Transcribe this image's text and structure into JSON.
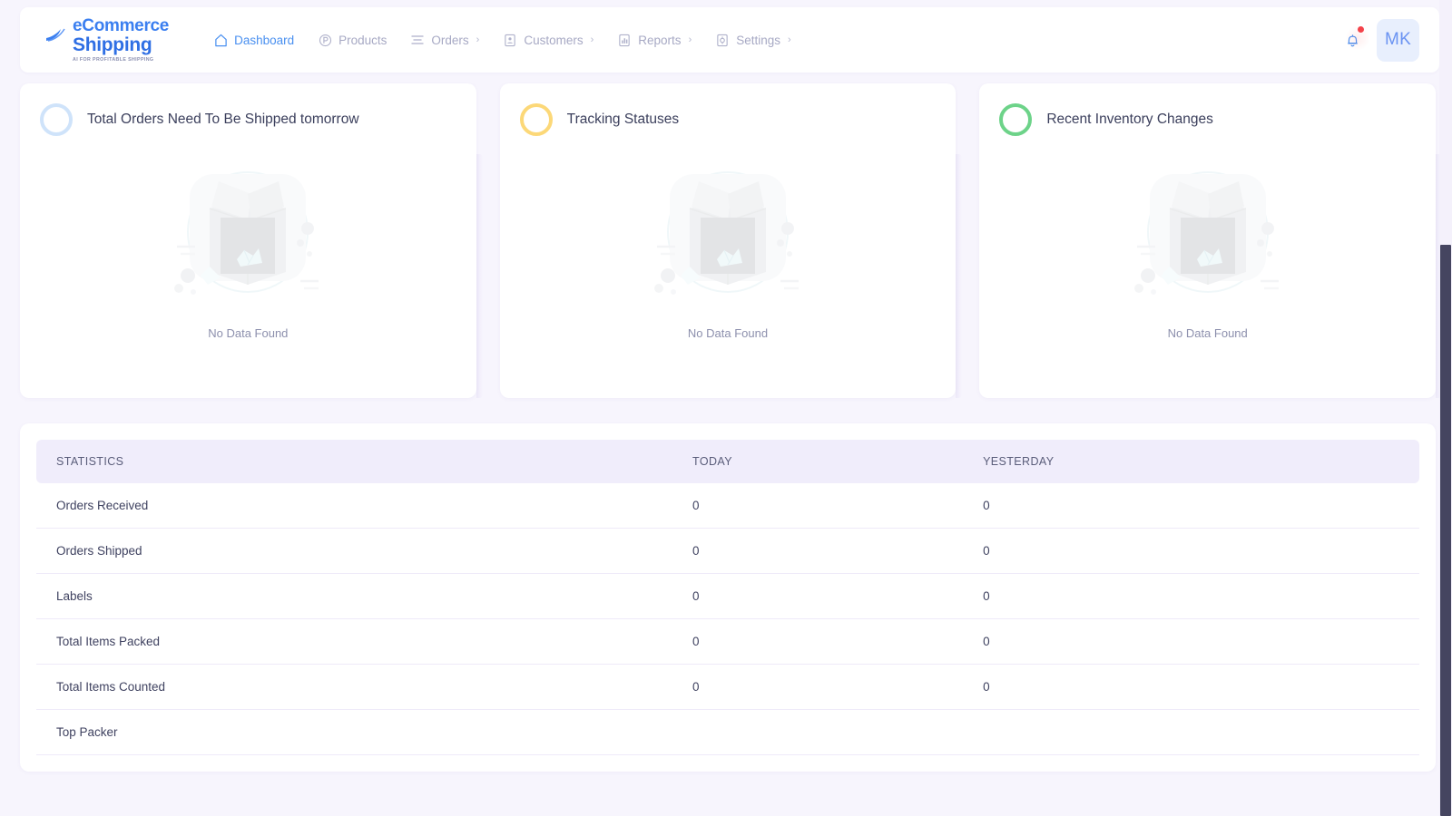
{
  "brand": {
    "name_line1": "eCommerce",
    "name_line2": "Shipping",
    "tagline": "AI FOR PROFITABLE SHIPPING",
    "logo_icon": "feather-wing-icon",
    "accent_color": "#3b7ff0"
  },
  "nav": {
    "items": [
      {
        "label": "Dashboard",
        "icon": "home-icon",
        "active": true,
        "has_chevron": false
      },
      {
        "label": "Products",
        "icon": "product-p-icon",
        "active": false,
        "has_chevron": false
      },
      {
        "label": "Orders",
        "icon": "list-lines-icon",
        "active": false,
        "has_chevron": true
      },
      {
        "label": "Customers",
        "icon": "id-card-icon",
        "active": false,
        "has_chevron": true
      },
      {
        "label": "Reports",
        "icon": "bar-chart-icon",
        "active": false,
        "has_chevron": true
      },
      {
        "label": "Settings",
        "icon": "gear-doc-icon",
        "active": false,
        "has_chevron": true
      }
    ],
    "chevron_glyph": "›"
  },
  "header_right": {
    "notification_icon": "bell-icon",
    "notification_dot": true,
    "notification_dot_color": "#f4424a",
    "avatar_initials": "MK",
    "avatar_bg": "#e8effd",
    "avatar_fg": "#6a93f2"
  },
  "cards": [
    {
      "title": "Total Orders Need To Be Shipped tomorrow",
      "ring_icon": "circle-ring-icon",
      "ring_color": "#cfe3fa",
      "empty_icon": "open-box-illustration",
      "empty_text": "No Data Found"
    },
    {
      "title": "Tracking Statuses",
      "ring_icon": "circle-ring-icon",
      "ring_color": "#fcd878",
      "empty_icon": "open-box-illustration",
      "empty_text": "No Data Found"
    },
    {
      "title": "Recent Inventory Changes",
      "ring_icon": "circle-ring-icon",
      "ring_color": "#6dd389",
      "empty_icon": "open-box-illustration",
      "empty_text": "No Data Found"
    }
  ],
  "stats_table": {
    "headers": [
      "STATISTICS",
      "TODAY",
      "YESTERDAY"
    ],
    "rows": [
      {
        "label": "Orders Received",
        "today": "0",
        "yesterday": "0"
      },
      {
        "label": "Orders Shipped",
        "today": "0",
        "yesterday": "0"
      },
      {
        "label": "Labels",
        "today": "0",
        "yesterday": "0"
      },
      {
        "label": "Total Items Packed",
        "today": "0",
        "yesterday": "0"
      },
      {
        "label": "Total Items Counted",
        "today": "0",
        "yesterday": "0"
      },
      {
        "label": "Top Packer",
        "today": "",
        "yesterday": ""
      }
    ]
  },
  "scrollbar": {
    "thumb_color": "#454560",
    "track_color": "#f4f1fb"
  },
  "page_background": "#f7f5fd"
}
